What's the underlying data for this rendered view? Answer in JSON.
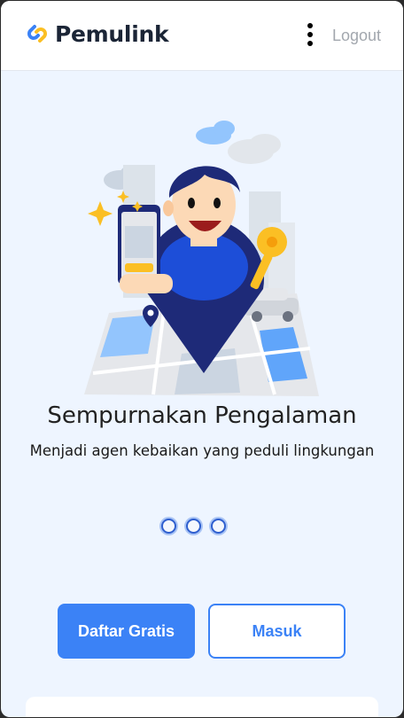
{
  "header": {
    "logo_text": "Pemulink",
    "logout_label": "Logout"
  },
  "onboarding": {
    "title": "Sempurnakan Pengalaman",
    "subtitle": "Menjadi agen kebaikan yang peduli lingkungan",
    "total_slides": 3
  },
  "actions": {
    "register_label": "Daftar Gratis",
    "login_label": "Masuk"
  },
  "colors": {
    "primary": "#3b82f6",
    "background": "#eef5ff",
    "logo_blue": "#3b82f6",
    "logo_yellow": "#fbbf24"
  },
  "icons": {
    "logo": "chain-link-icon",
    "menu": "more-vertical-icon",
    "illustration": "map-pin-person-holding-phone-and-key"
  }
}
